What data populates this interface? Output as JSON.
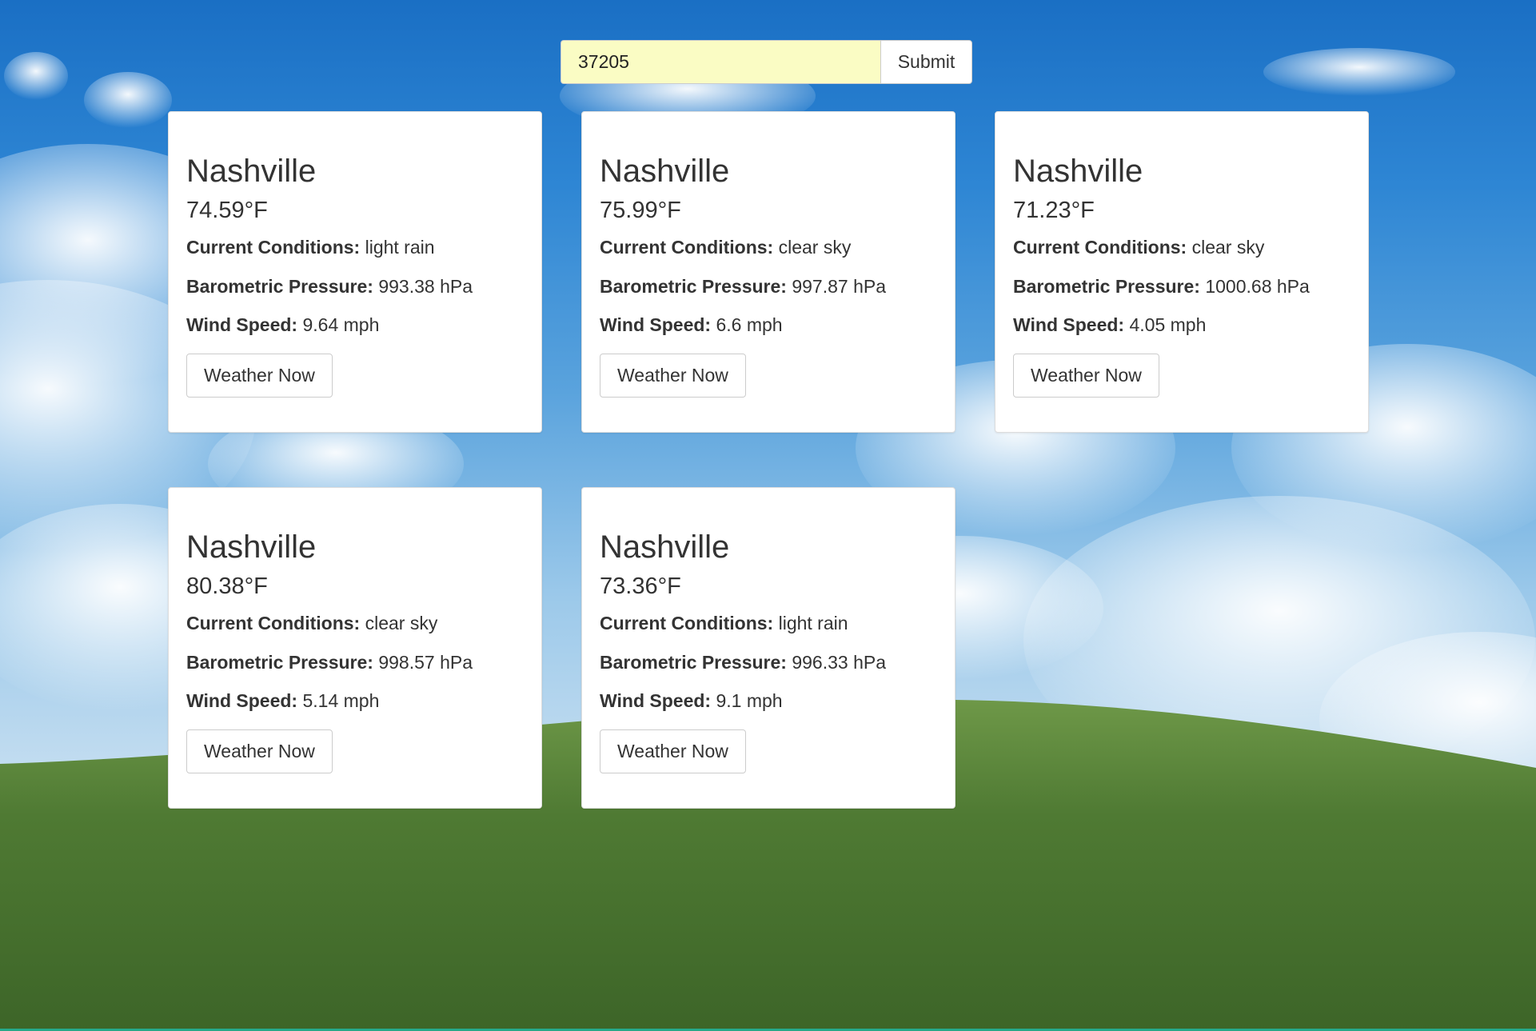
{
  "search": {
    "zip_value": "37205",
    "submit_label": "Submit"
  },
  "labels": {
    "conditions": "Current Conditions:",
    "pressure": "Barometric Pressure:",
    "wind": "Wind Speed:"
  },
  "cards": [
    {
      "city": "Nashville",
      "temp": "74.59°F",
      "conditions": "light rain",
      "pressure": "993.38 hPa",
      "wind": "9.64 mph",
      "button": "Weather Now"
    },
    {
      "city": "Nashville",
      "temp": "75.99°F",
      "conditions": "clear sky",
      "pressure": "997.87 hPa",
      "wind": "6.6 mph",
      "button": "Weather Now"
    },
    {
      "city": "Nashville",
      "temp": "71.23°F",
      "conditions": "clear sky",
      "pressure": "1000.68 hPa",
      "wind": "4.05 mph",
      "button": "Weather Now"
    },
    {
      "city": "Nashville",
      "temp": "80.38°F",
      "conditions": "clear sky",
      "pressure": "998.57 hPa",
      "wind": "5.14 mph",
      "button": "Weather Now"
    },
    {
      "city": "Nashville",
      "temp": "73.36°F",
      "conditions": "light rain",
      "pressure": "996.33 hPa",
      "wind": "9.1 mph",
      "button": "Weather Now"
    }
  ],
  "colors": {
    "input_background": "#fafcc4",
    "sky": "#2e86d4",
    "grass": "#4f7a33",
    "accent_line": "#25a98a"
  }
}
